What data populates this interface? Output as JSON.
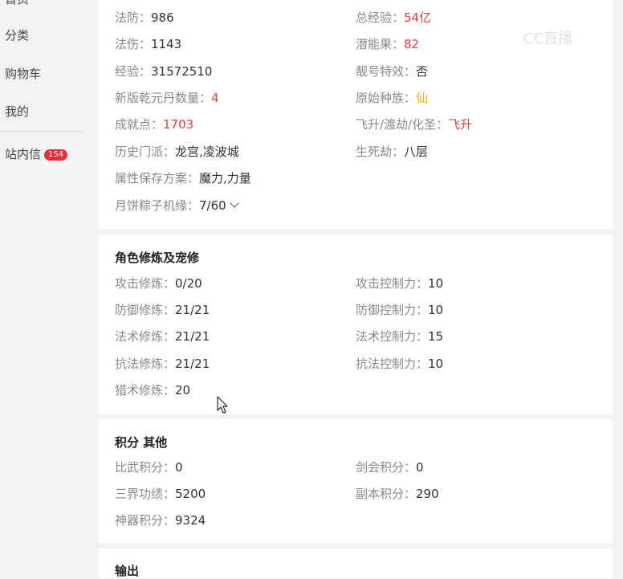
{
  "sidebar": {
    "items": [
      {
        "label": "首页"
      },
      {
        "label": "分类"
      },
      {
        "label": "购物车"
      },
      {
        "label": "我的"
      },
      {
        "label": "站内信",
        "badge": "154"
      }
    ]
  },
  "watermark": "CC直播",
  "card1": {
    "left": [
      {
        "k": "法防：",
        "v": "986"
      },
      {
        "k": "法伤：",
        "v": "1143"
      },
      {
        "k": "经验：",
        "v": "31572510"
      },
      {
        "k": "新版乾元丹数量：",
        "v": "4"
      },
      {
        "k": "成就点：",
        "v": "1703"
      },
      {
        "k": "历史门派：",
        "v": "龙宫,凌波城"
      },
      {
        "k": "属性保存方案：",
        "v": "魔力,力量"
      },
      {
        "k": "月饼粽子机缘：",
        "v": "7/60"
      }
    ],
    "right": [
      {
        "k": "总经验：",
        "v": "54亿"
      },
      {
        "k": "潜能果：",
        "v": "82"
      },
      {
        "k": "靓号特效：",
        "v": "否"
      },
      {
        "k": "原始种族：",
        "v": "仙"
      },
      {
        "k": "飞升/渡劫/化圣：",
        "v": "飞升"
      },
      {
        "k": "生死劫：",
        "v": "八层"
      }
    ]
  },
  "card2": {
    "title": "角色修炼及宠修",
    "left": [
      {
        "k": "攻击修炼：",
        "v": "0/20"
      },
      {
        "k": "防御修炼：",
        "v": "21/21"
      },
      {
        "k": "法术修炼：",
        "v": "21/21"
      },
      {
        "k": "抗法修炼：",
        "v": "21/21"
      },
      {
        "k": "猎术修炼：",
        "v": "20"
      }
    ],
    "right": [
      {
        "k": "攻击控制力：",
        "v": "10"
      },
      {
        "k": "防御控制力：",
        "v": "10"
      },
      {
        "k": "法术控制力：",
        "v": "15"
      },
      {
        "k": "抗法控制力：",
        "v": "10"
      }
    ]
  },
  "card3": {
    "title": "积分 其他",
    "left": [
      {
        "k": "比武积分：",
        "v": "0"
      },
      {
        "k": "三界功绩：",
        "v": "5200"
      },
      {
        "k": "神器积分：",
        "v": "9324"
      }
    ],
    "right": [
      {
        "k": "剑会积分：",
        "v": "0"
      },
      {
        "k": "副本积分：",
        "v": "290"
      }
    ]
  },
  "card4": {
    "title": "输出"
  }
}
